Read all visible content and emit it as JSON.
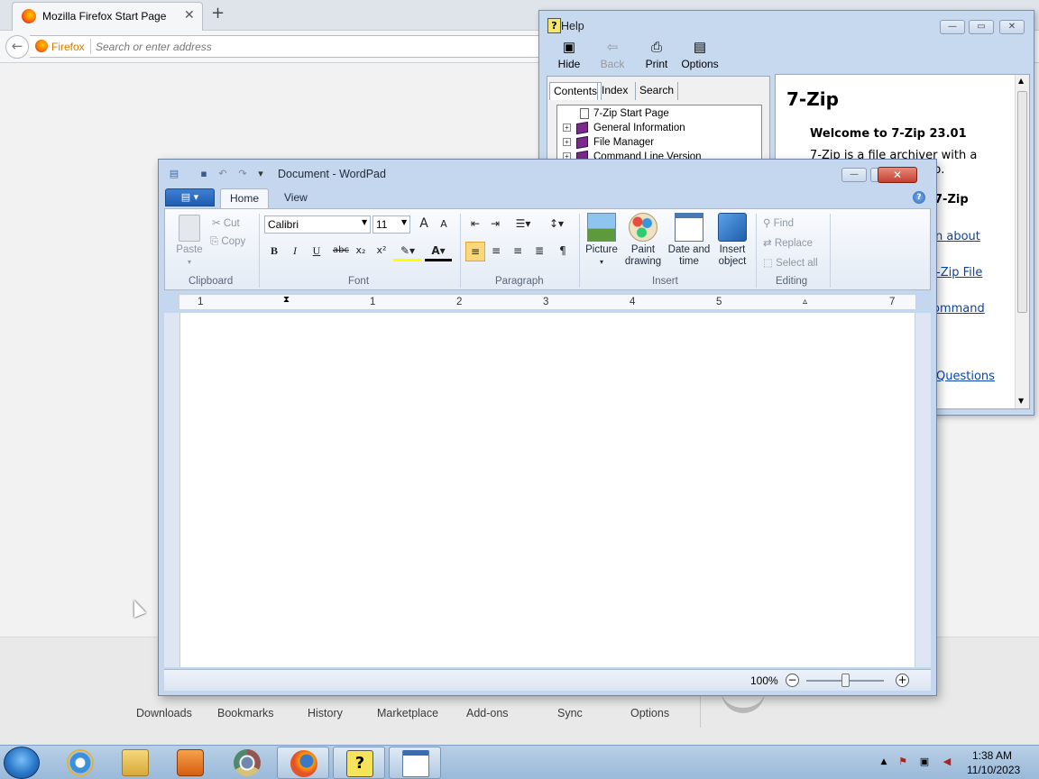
{
  "firefox": {
    "tab_title": "Mozilla Firefox Start Page",
    "close_glyph": "✕",
    "new_tab_glyph": "+",
    "back_glyph": "←",
    "identity_label": "Firefox",
    "url_placeholder": "Search or enter address",
    "launcher": [
      "Downloads",
      "Bookmarks",
      "History",
      "Marketplace",
      "Add-ons",
      "Sync",
      "Options"
    ]
  },
  "help": {
    "title": "Help",
    "toolbar": [
      {
        "label": "Hide",
        "icon": "hide-icon"
      },
      {
        "label": "Back",
        "icon": "back-arrow-icon"
      },
      {
        "label": "Print",
        "icon": "printer-icon"
      },
      {
        "label": "Options",
        "icon": "options-icon"
      }
    ],
    "tabs": [
      "Contents",
      "Index",
      "Search"
    ],
    "tree": [
      {
        "label": "7-Zip Start Page",
        "type": "page"
      },
      {
        "label": "General Information",
        "type": "book"
      },
      {
        "label": "File Manager",
        "type": "book"
      },
      {
        "label": "Command Line Version",
        "type": "book"
      }
    ],
    "content": {
      "heading": "7-Zip",
      "subheading": "Welcome to 7-Zip 23.01",
      "paragraph": "7-Zip is a file archiver with a",
      "paragraph_cont": "p.",
      "partial_heading": "7-Zip",
      "links": [
        "n about",
        "-Zip File",
        "ommand",
        "Questions"
      ]
    }
  },
  "wordpad": {
    "title": "Document - WordPad",
    "tabs": [
      "Home",
      "View"
    ],
    "clipboard": {
      "paste": "Paste",
      "cut": "Cut",
      "copy": "Copy",
      "group": "Clipboard"
    },
    "font": {
      "family": "Calibri",
      "size": "11",
      "group": "Font",
      "bold": "B",
      "italic": "I",
      "underline": "U",
      "strike": "abc"
    },
    "paragraph_group": "Paragraph",
    "insert": {
      "picture": "Picture",
      "paint": "Paint drawing",
      "datetime": "Date and time",
      "object": "Insert object",
      "group": "Insert"
    },
    "editing": {
      "find": "Find",
      "replace": "Replace",
      "select_all": "Select all",
      "group": "Editing"
    },
    "ruler_numbers": [
      "1",
      "1",
      "2",
      "3",
      "4",
      "5",
      "7"
    ],
    "zoom": "100%",
    "zoom_level_percent": 50
  },
  "taskbar": {
    "time": "1:38 AM",
    "date": "11/10/2023",
    "apps": [
      "internet-explorer",
      "file-explorer",
      "media-player",
      "chrome",
      "firefox",
      "help",
      "wordpad"
    ]
  }
}
